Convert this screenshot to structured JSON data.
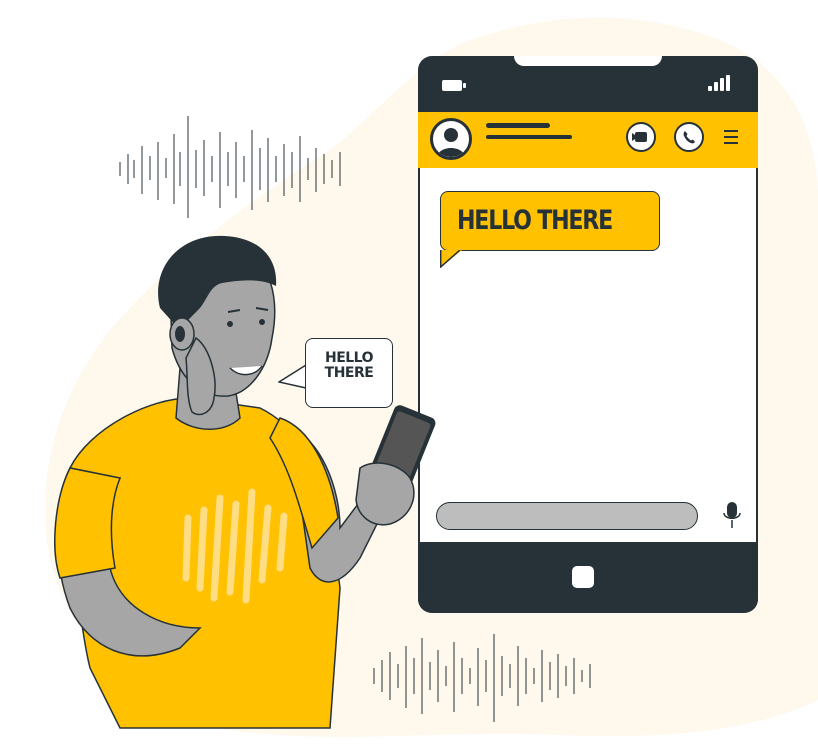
{
  "chat": {
    "message": "HELLO THERE"
  },
  "speech_bubble": {
    "line1": "HELLO",
    "line2": "THERE"
  },
  "icons": {
    "battery": "battery-icon",
    "signal": "signal-icon",
    "avatar": "user-avatar-icon",
    "video": "video-camera-icon",
    "call": "phone-icon",
    "menu": "hamburger-menu-icon",
    "mic": "microphone-icon",
    "home": "home-button-icon"
  },
  "colors": {
    "accent": "#FFC100",
    "dark": "#263238",
    "input": "#BDBDBD",
    "background_blob": "#FFF8EC",
    "skin": "#A6A6A6"
  }
}
